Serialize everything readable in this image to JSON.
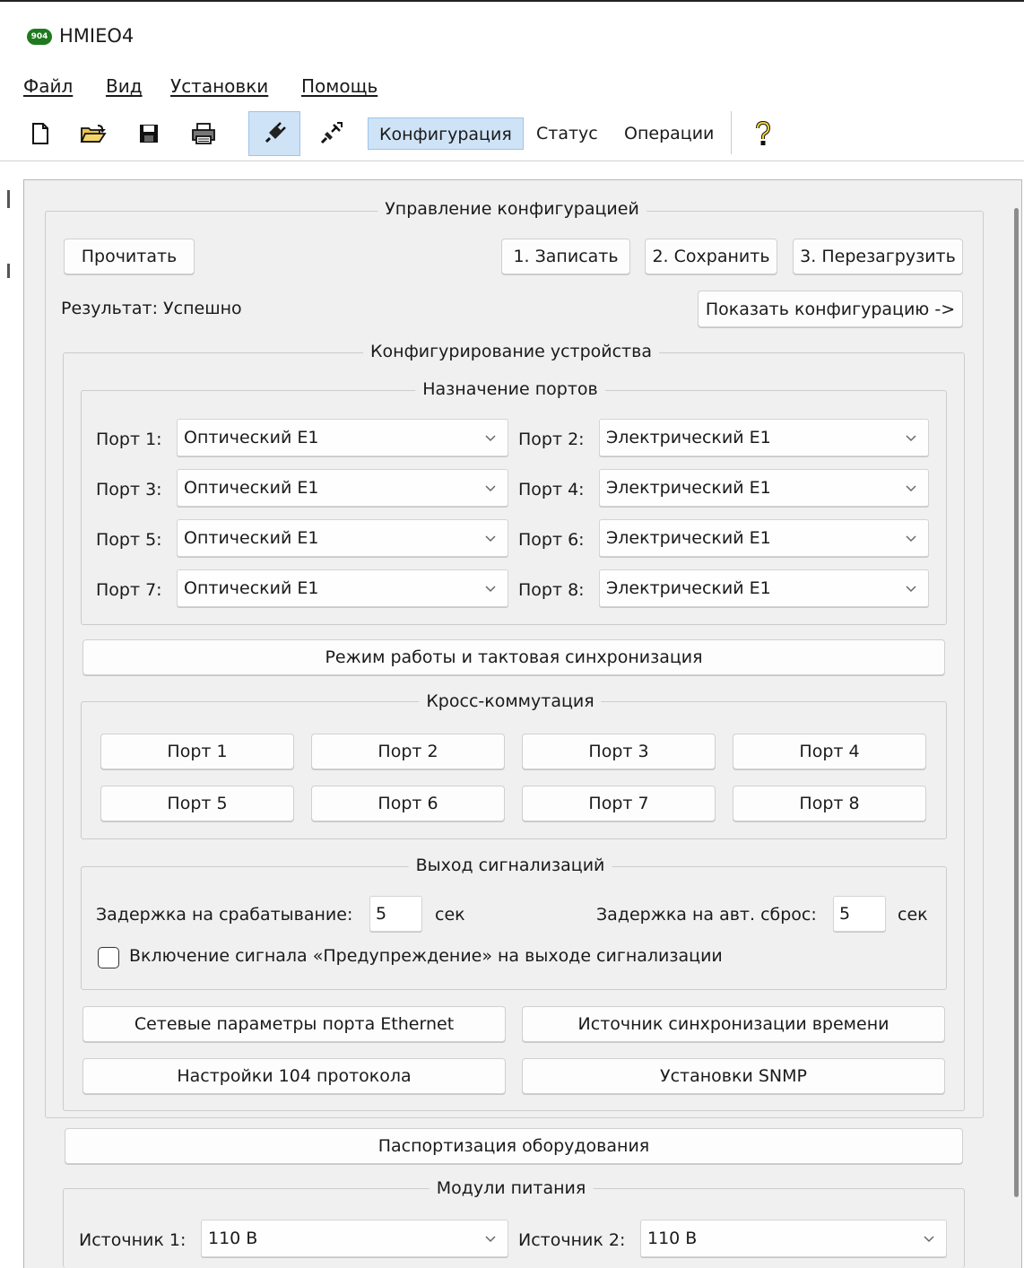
{
  "window": {
    "title": "HMIEO4",
    "logo_text": "904"
  },
  "menu": {
    "items": [
      "Файл",
      "Вид",
      "Установки",
      "Помощь"
    ]
  },
  "toolbar": {
    "tabs": [
      "Конфигурация",
      "Статус",
      "Операции"
    ],
    "active_tab": "Конфигурация",
    "colors": {
      "active": "#cfe3f7",
      "active_border": "#9cc4ea"
    }
  },
  "config_mgmt": {
    "title": "Управление конфигурацией",
    "read_button": "Прочитать",
    "write_button": "1. Записать",
    "save_button": "2. Сохранить",
    "reboot_button": "3. Перезагрузить",
    "result_text": "Результат: Успешно",
    "show_config_button": "Показать конфигурацию ->"
  },
  "device_config": {
    "title": "Конфигурирование устройства"
  },
  "ports": {
    "title": "Назначение портов",
    "rows": [
      {
        "left_label": "Порт 1:",
        "left_value": "Оптический Е1",
        "right_label": "Порт 2:",
        "right_value": "Электрический Е1"
      },
      {
        "left_label": "Порт 3:",
        "left_value": "Оптический Е1",
        "right_label": "Порт 4:",
        "right_value": "Электрический Е1"
      },
      {
        "left_label": "Порт 5:",
        "left_value": "Оптический Е1",
        "right_label": "Порт 6:",
        "right_value": "Электрический Е1"
      },
      {
        "left_label": "Порт 7:",
        "left_value": "Оптический Е1",
        "right_label": "Порт 8:",
        "right_value": "Электрический Е1"
      }
    ]
  },
  "mode_button": "Режим работы и тактовая синхронизация",
  "cross": {
    "title": "Кросс-коммутация",
    "buttons": [
      "Порт 1",
      "Порт 2",
      "Порт 3",
      "Порт 4",
      "Порт 5",
      "Порт 6",
      "Порт 7",
      "Порт 8"
    ]
  },
  "alarm": {
    "title": "Выход сигнализаций",
    "trigger_delay_label": "Задержка на срабатывание:",
    "trigger_delay_value": "5",
    "unit": "сек",
    "reset_delay_label": "Задержка на авт. сброс:",
    "reset_delay_value": "5",
    "warning_checkbox_label": "Включение сигнала «Предупреждение» на выходе сигнализации",
    "warning_checked": false
  },
  "extra_buttons": {
    "ethernet": "Сетевые параметры порта Ethernet",
    "time_sync": "Источник синхронизации времени",
    "protocol104": "Настройки 104 протокола",
    "snmp": "Установки SNMP"
  },
  "passport_button": "Паспортизация оборудования",
  "power": {
    "title": "Модули питания",
    "source1_label": "Источник 1:",
    "source1_value": "110 В",
    "source2_label": "Источник 2:",
    "source2_value": "110 В"
  }
}
